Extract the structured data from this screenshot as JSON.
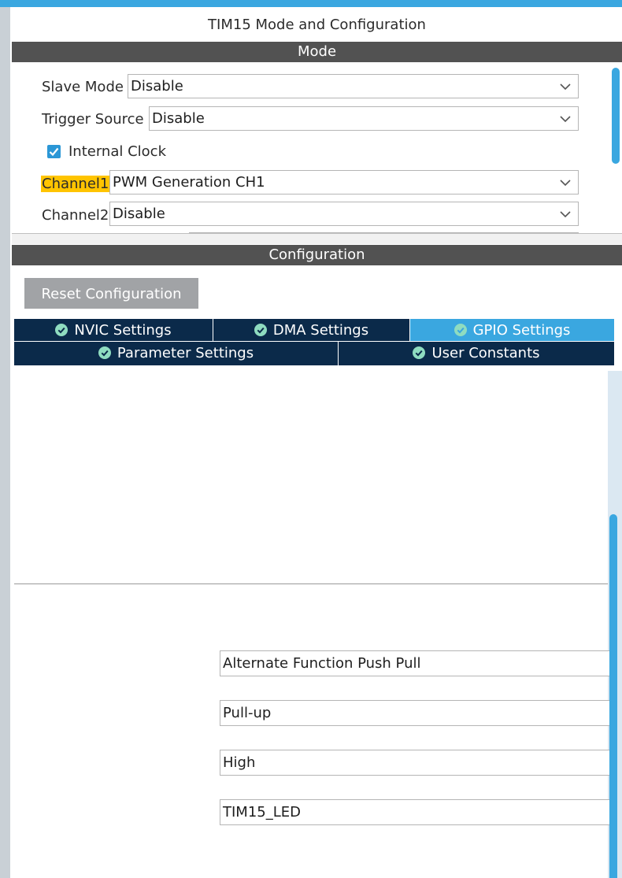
{
  "panel_title": "TIM15 Mode and Configuration",
  "mode": {
    "header": "Mode",
    "slave_mode": {
      "label": "Slave Mode",
      "value": "Disable"
    },
    "trigger_source": {
      "label": "Trigger Source",
      "value": "Disable"
    },
    "internal_clock": {
      "label": "Internal Clock",
      "checked": true
    },
    "channel1": {
      "label": "Channel1",
      "value": "PWM Generation CH1"
    },
    "channel2": {
      "label": "Channel2",
      "value": "Disable"
    }
  },
  "configuration": {
    "header": "Configuration",
    "reset_button": "Reset Configuration",
    "tabs": [
      {
        "label": "NVIC Settings",
        "active": false
      },
      {
        "label": "DMA Settings",
        "active": false
      },
      {
        "label": "GPIO Settings",
        "active": true
      },
      {
        "label": "Parameter Settings",
        "active": false
      },
      {
        "label": "User Constants",
        "active": false
      }
    ],
    "gpio_fields": [
      "Alternate Function Push Pull",
      "Pull-up",
      "High",
      "TIM15_LED"
    ]
  },
  "colors": {
    "accent": "#3aa7e0",
    "tab_bg": "#0b2a4a",
    "section_header_bg": "#525252",
    "highlight": "#ffc400",
    "reset_button_bg": "#a1a3a6"
  },
  "icons": {
    "dropdown": "chevron-down-icon",
    "tab_status": "check-circle-icon",
    "checkbox": "checkmark-icon"
  }
}
